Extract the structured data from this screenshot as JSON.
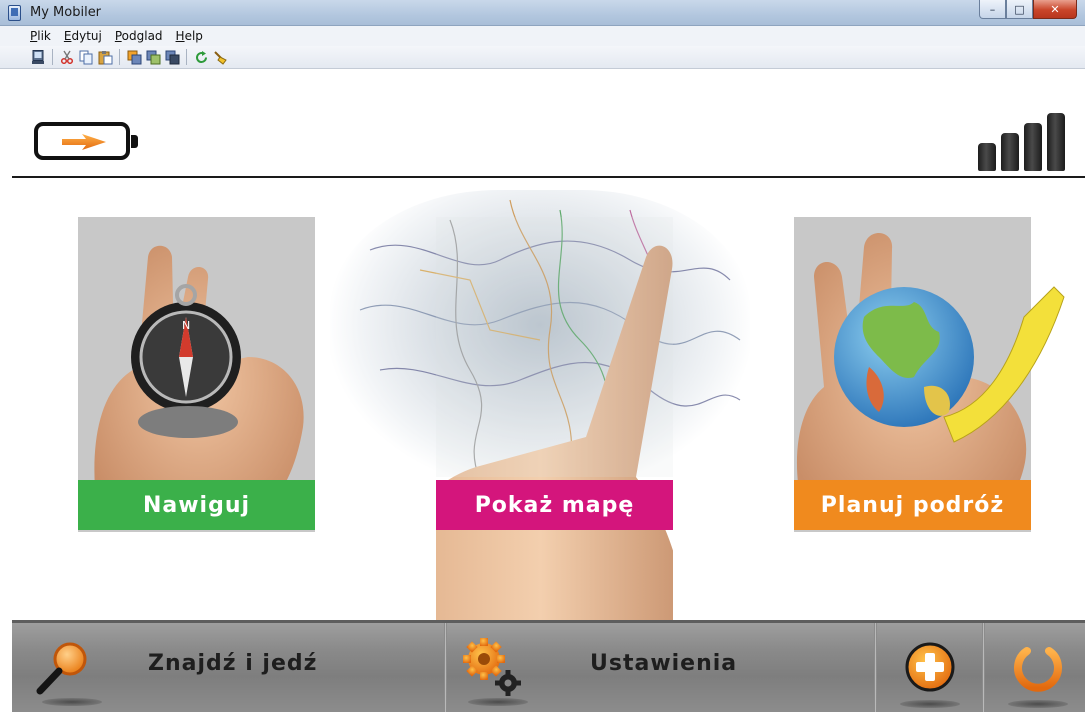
{
  "window": {
    "title": "My Mobiler",
    "minimize": "–",
    "maximize": "□",
    "close": "✕"
  },
  "menu": {
    "items": [
      "Plik",
      "Edytuj",
      "Podglad",
      "Help"
    ]
  },
  "toolbar": {
    "icons": [
      "device-icon",
      "cut-icon",
      "copy-icon",
      "paste-icon",
      "window-copy-icon",
      "window-paste-icon",
      "window-tile-icon",
      "refresh-icon",
      "clean-icon"
    ]
  },
  "status": {
    "battery_state": "charging",
    "signal_bars": 4
  },
  "tiles": [
    {
      "label": "Nawiguj",
      "color": "#3bb04a",
      "image": "hand-holding-compass"
    },
    {
      "label": "Pokaż mapę",
      "color": "#d4157c",
      "image": "finger-pointing-on-map"
    },
    {
      "label": "Planuj podróż",
      "color": "#f08a1e",
      "image": "hand-holding-globe"
    }
  ],
  "bottom": {
    "search_label": "Znajdź i jedź",
    "settings_label": "Ustawienia",
    "add_icon": "plus-circle-icon",
    "power_icon": "power-icon"
  },
  "colors": {
    "accent_orange": "#f08a1e",
    "nav_green": "#3bb04a",
    "map_magenta": "#d4157c",
    "bottom_bar": "#8a8a8a"
  }
}
